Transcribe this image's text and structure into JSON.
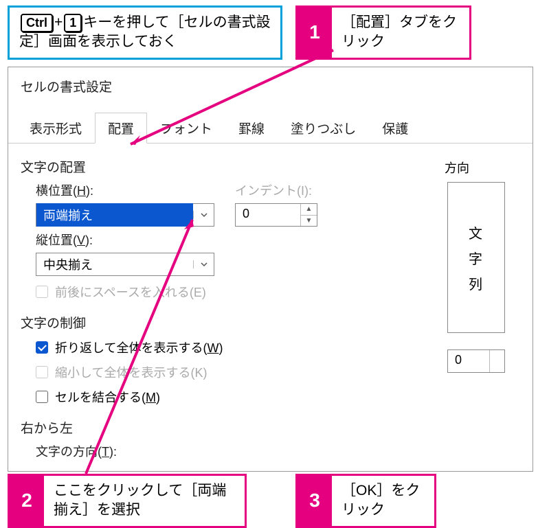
{
  "callouts": {
    "pre": {
      "key1": "Ctrl",
      "plus": "+",
      "key2": "1",
      "rest": "キーを押して［セルの書式設定］画面を表示しておく"
    },
    "c1": {
      "num": "1",
      "txt": "［配置］タブをクリック"
    },
    "c2": {
      "num": "2",
      "txt": "ここをクリックして［両端揃え］を選択"
    },
    "c3": {
      "num": "3",
      "txt": "［OK］をクリック"
    }
  },
  "dialog": {
    "title": "セルの書式設定",
    "tabs": [
      "表示形式",
      "配置",
      "フォント",
      "罫線",
      "塗りつぶし",
      "保護"
    ],
    "activeTab": 1,
    "groups": {
      "align": "文字の配置",
      "control": "文字の制御",
      "rtl": "右から左"
    },
    "horiz": {
      "label_pre": "横位置(",
      "ul": "H",
      "label_post": "):",
      "value": "両端揃え"
    },
    "indent": {
      "label": "インデント(I):",
      "value": "0"
    },
    "vert": {
      "label_pre": "縦位置(",
      "ul": "V",
      "label_post": "):",
      "value": "中央揃え"
    },
    "opts": {
      "space": "前後にスペースを入れる(E)",
      "wrap_pre": "折り返して全体を表示する(",
      "wrap_ul": "W",
      "wrap_post": ")",
      "shrink": "縮小して全体を表示する(K)",
      "merge_pre": "セルを結合する(",
      "merge_ul": "M",
      "merge_post": ")"
    },
    "rtl_dir": {
      "label_pre": "文字の方向(",
      "ul": "T",
      "label_post": "):"
    },
    "orient": {
      "label": "方向",
      "ch1": "文",
      "ch2": "字",
      "ch3": "列",
      "deg": "0"
    }
  }
}
